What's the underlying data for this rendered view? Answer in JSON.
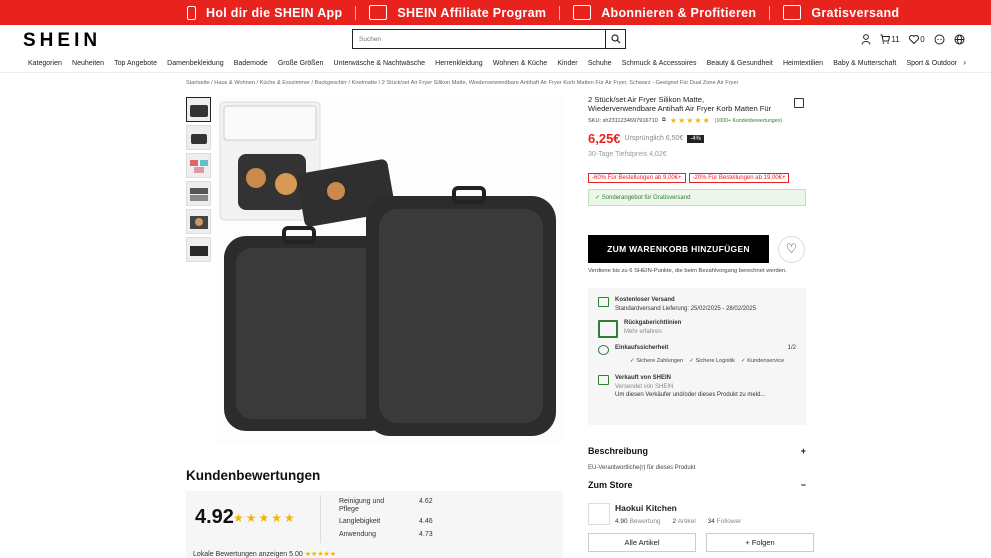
{
  "promo": {
    "items": [
      {
        "icon": "phone-icon",
        "text": "Hol dir die SHEIN App"
      },
      {
        "icon": "megaphone-icon",
        "text": "SHEIN Affiliate Program"
      },
      {
        "icon": "bell-icon",
        "text": "Abonnieren & Profitieren"
      },
      {
        "icon": "truck-icon",
        "text": "Gratisversand"
      }
    ]
  },
  "header": {
    "logo": "SHEIN",
    "search_placeholder": "Suchen",
    "cart_count": "11",
    "wish_count": "0"
  },
  "nav": {
    "items": [
      "Kategorien",
      "Neuheiten",
      "Top Angebote",
      "Damenbekleidung",
      "Bademode",
      "Große Größen",
      "Unterwäsche & Nachtwäsche",
      "Herrenkleidung",
      "Wohnen & Küche",
      "Kinder",
      "Schuhe",
      "Schmuck & Accessoires",
      "Beauty & Gesundheit",
      "Heimtextilien",
      "Baby & Mutterschaft",
      "Sport & Outdoor"
    ]
  },
  "breadcrumb": "Startseite / Haus & Wohnen / Küche & Esszimmer / Backgeschirr / Knetmatte / 2 Stück/set Air Fryer Silikon Matte, Wiederverwendbare Antihaft Air Fryer Korb Matten Für Air Fryer, Schwarz - Geeignet Für Dual Zone Air Fryer",
  "product": {
    "title": "2 Stück/set Air Fryer Silikon Matte, Wiederverwendbare Antihaft Air Fryer Korb Matten Für Air Fryer, Schwarz - Geeignet Für Dual Zone Air Fryer",
    "sku": "SKU: sh2311234697916710",
    "stars": "★★★★★",
    "reviews": "(1000+ Kundenbewertungen)",
    "price": "6,25€",
    "original": "Ursprünglich 6,50€",
    "discount": "-4%",
    "lowest": "30-Tage Tiefstpreis 4,02€",
    "coupons": [
      "-60% Für Bestellungen ab 9,00€+",
      "-20% Für Bestellungen ab 19,00€+"
    ],
    "free_ship": "Sonderangebot für Gratisversand",
    "cart_button": "ZUM WARENKORB HINZUFÜGEN",
    "points": "Verdiene bis zu 6 SHEIN-Punkte, die beim Bezahlvorgang berechnet werden."
  },
  "info": {
    "shipping_title": "Kostenloser Versand",
    "shipping_detail": "Standardversand Lieferung: 25/02/2025 - 28/02/2025",
    "returns_title": "Rückgaberichtlinien",
    "returns_detail": "Mehr erfahren",
    "security_title": "Einkaufssicherheit",
    "security_page": "1/2",
    "security_chips": [
      "Sichere Zahlungen",
      "Sichere Logistik",
      "Kundenservice"
    ],
    "seller_title": "Verkauft von SHEIN",
    "seller_sub": "Versendet von SHEIN",
    "seller_link": "Um diesen Verkäufer und/oder dieses Produkt zu meld..."
  },
  "sections": {
    "description": "Beschreibung",
    "eu": "EU-Verantwortliche(r) für dieses Produkt",
    "store": "Zum Store"
  },
  "store": {
    "name": "Haokui Kitchen",
    "rating": "4.90",
    "rating_label": "Bewertung",
    "articles": "2",
    "articles_label": "Artikel",
    "followers": "34",
    "followers_label": "Follower",
    "all_button": "Alle Artikel",
    "follow_button": "+ Folgen"
  },
  "reviews": {
    "title": "Kundenbewertungen",
    "score": "4.92",
    "stars": "★★★★★",
    "metrics": [
      {
        "label": "Reinigung und Pflege",
        "value": "4.62"
      },
      {
        "label": "Langlebigkeit",
        "value": "4.46"
      },
      {
        "label": "Anwendung",
        "value": "4.73"
      }
    ],
    "local": "Lokale Bewertungen anzeigen 5.00"
  }
}
